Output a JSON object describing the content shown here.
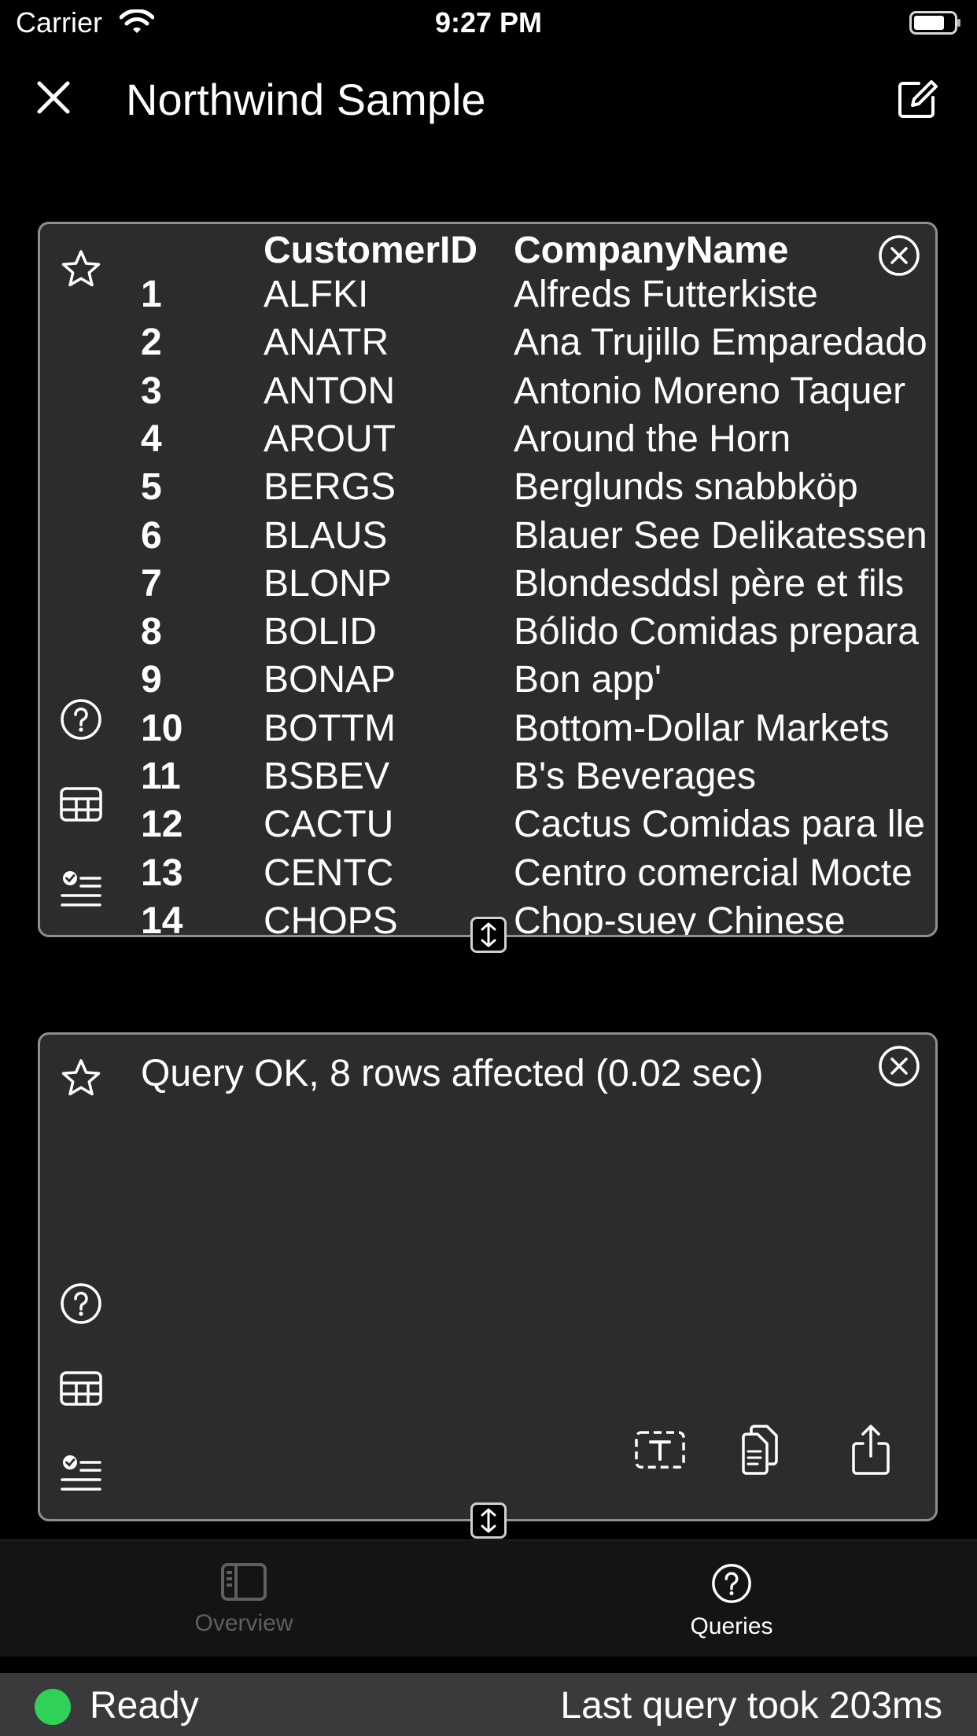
{
  "status_bar": {
    "carrier": "Carrier",
    "time": "9:27 PM"
  },
  "nav": {
    "title": "Northwind Sample"
  },
  "results_panel": {
    "columns": [
      "CustomerID",
      "CompanyName"
    ],
    "rows": [
      {
        "n": "1",
        "id": "ALFKI",
        "name": "Alfreds Futterkiste"
      },
      {
        "n": "2",
        "id": "ANATR",
        "name": "Ana Trujillo Emparedado"
      },
      {
        "n": "3",
        "id": "ANTON",
        "name": "Antonio Moreno Taquer"
      },
      {
        "n": "4",
        "id": "AROUT",
        "name": "Around the Horn"
      },
      {
        "n": "5",
        "id": "BERGS",
        "name": "Berglunds snabbköp"
      },
      {
        "n": "6",
        "id": "BLAUS",
        "name": "Blauer See Delikatessen"
      },
      {
        "n": "7",
        "id": "BLONP",
        "name": "Blondesddsl père et fils"
      },
      {
        "n": "8",
        "id": "BOLID",
        "name": "Bólido Comidas prepara"
      },
      {
        "n": "9",
        "id": "BONAP",
        "name": "Bon app'"
      },
      {
        "n": "10",
        "id": "BOTTM",
        "name": "Bottom-Dollar Markets"
      },
      {
        "n": "11",
        "id": "BSBEV",
        "name": "B's Beverages"
      },
      {
        "n": "12",
        "id": "CACTU",
        "name": "Cactus Comidas para lle"
      },
      {
        "n": "13",
        "id": "CENTC",
        "name": "Centro comercial Mocte"
      },
      {
        "n": "14",
        "id": "CHOPS",
        "name": "Chop-suey Chinese"
      }
    ]
  },
  "query_panel": {
    "message": "Query OK, 8 rows affected (0.02 sec)"
  },
  "tabs": [
    {
      "label": "Overview",
      "icon": "sidebar-icon",
      "selected": false
    },
    {
      "label": "Queries",
      "icon": "question-circle-icon",
      "selected": true
    }
  ],
  "footer": {
    "status": "Ready",
    "status_color": "#30d158",
    "last_query": "Last query took 203ms"
  },
  "colors": {
    "panel_bg": "#2c2c2e",
    "panel_border": "#8e8e93",
    "background": "#000000"
  }
}
